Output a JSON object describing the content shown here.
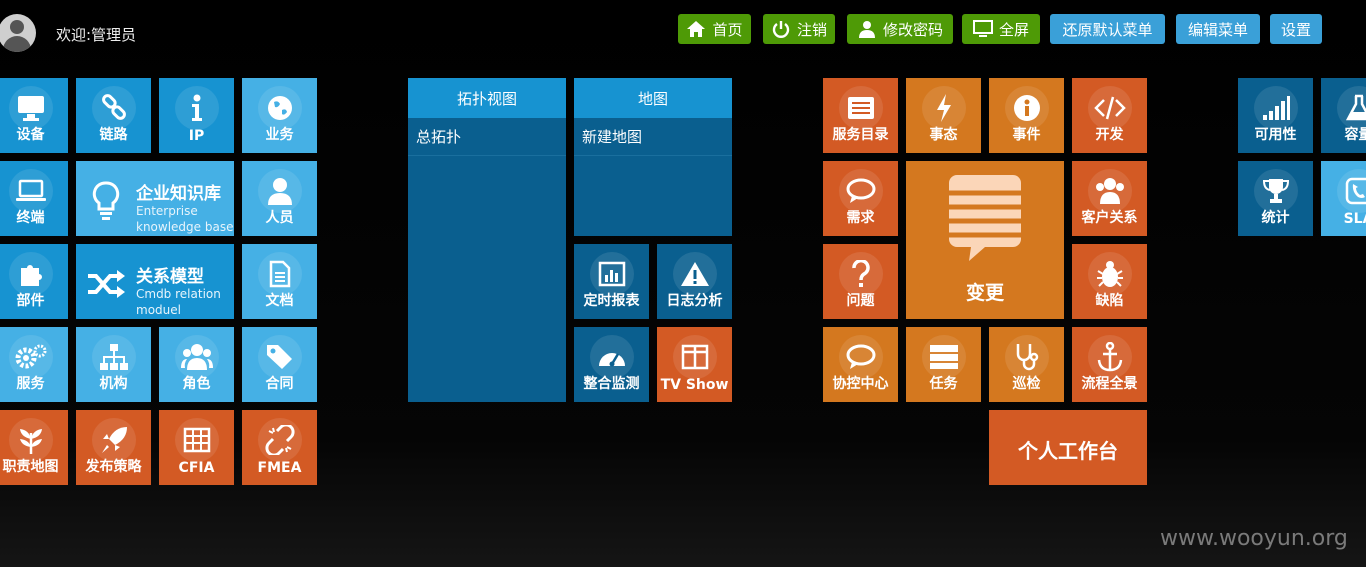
{
  "header": {
    "welcome": "欢迎:管理员",
    "buttons": [
      {
        "label": "首页",
        "icon": "home-icon"
      },
      {
        "label": "注销",
        "icon": "power-icon"
      },
      {
        "label": "修改密码",
        "icon": "user-icon"
      },
      {
        "label": "全屏",
        "icon": "monitor-icon"
      },
      {
        "label": "还原默认菜单"
      },
      {
        "label": "编辑菜单"
      },
      {
        "label": "设置"
      }
    ]
  },
  "left_group": {
    "device": "设备",
    "link": "链路",
    "ip": "IP",
    "business": "业务",
    "terminal": "终端",
    "knowledge": {
      "title": "企业知识库",
      "sub1": "Enterprise",
      "sub2": "knowledge base"
    },
    "personnel": "人员",
    "component": "部件",
    "relation": {
      "title": "关系模型",
      "sub1": "Cmdb relation",
      "sub2": "moduel"
    },
    "document": "文档",
    "service": "服务",
    "org": "机构",
    "role": "角色",
    "contract": "合同",
    "duty_map": "职责地图",
    "release": "发布策略",
    "cfia": "CFIA",
    "fmea": "FMEA"
  },
  "middle_group": {
    "topology": {
      "title": "拓扑视图",
      "item": "总拓扑"
    },
    "map": {
      "title": "地图",
      "item": "新建地图"
    },
    "scheduled_report": "定时报表",
    "log_analysis": "日志分析",
    "monitor": "整合监测",
    "tv_show": "TV Show"
  },
  "right_group": {
    "catalog": "服务目录",
    "event_state": "事态",
    "incident": "事件",
    "develop": "开发",
    "demand": "需求",
    "change": "变更",
    "customer": "客户关系",
    "problem": "问题",
    "defect": "缺陷",
    "coordination": "协控中心",
    "task": "任务",
    "inspection": "巡检",
    "process": "流程全景",
    "workbench": "个人工作台"
  },
  "far_right_group": {
    "availability": "可用性",
    "capacity": "容量",
    "statistics": "统计",
    "sla": "SLA"
  },
  "watermark": "www.wooyun.org",
  "colors": {
    "blue": "#1793d1",
    "light_blue": "#45b0e5",
    "dark_blue": "#0a5f8f",
    "orange": "#d35a24",
    "amber": "#d4781f",
    "green": "#4e9a06"
  }
}
